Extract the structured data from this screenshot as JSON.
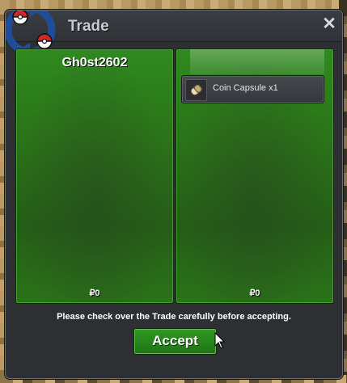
{
  "window": {
    "title": "Trade"
  },
  "icons": {
    "logo": "pokeball-arrows-icon",
    "close": "close-icon",
    "item": "coin-capsule-icon",
    "cursor": "mouse-cursor-icon"
  },
  "close_glyph": "✕",
  "trade": {
    "left": {
      "player_name": "Gh0st2602",
      "money": "₽0",
      "items": []
    },
    "right": {
      "player_name": "",
      "money": "₽0",
      "items": [
        {
          "label": "Coin Capsule  x1"
        }
      ]
    }
  },
  "notice": "Please check over the Trade carefully before accepting.",
  "accept_label": "Accept",
  "colors": {
    "panel_green": "#2a7419",
    "accept_green": "#2f9a21",
    "window_bg": "#2d2f33"
  }
}
